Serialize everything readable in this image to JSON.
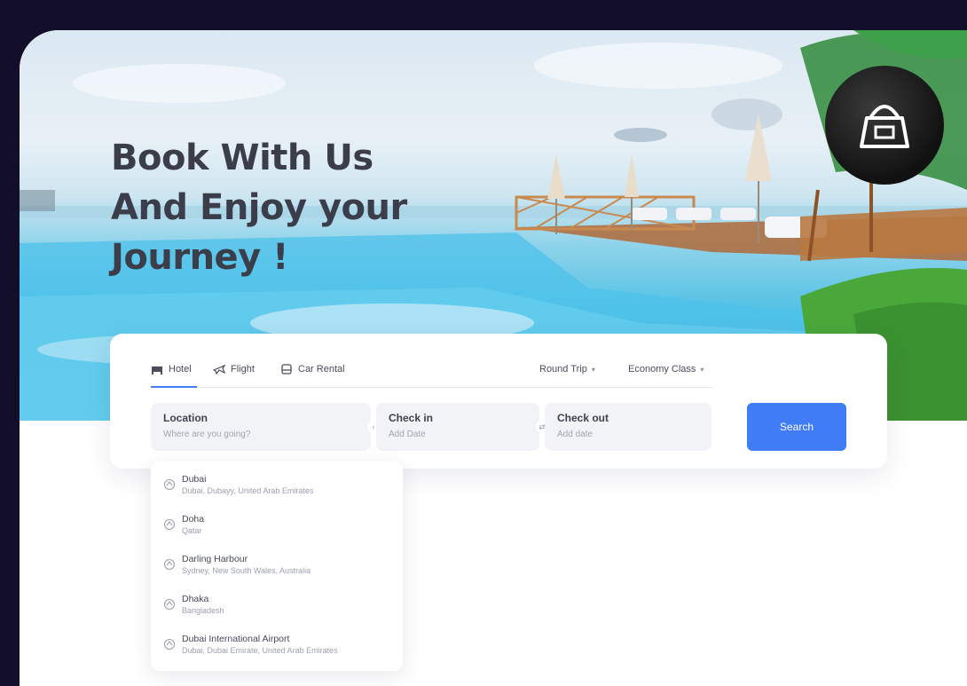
{
  "hero": {
    "headline": [
      "Book With Us",
      "And Enjoy your",
      "Journey !"
    ]
  },
  "badge": {
    "icon": "shopping-bag-icon"
  },
  "search": {
    "tabs": [
      {
        "label": "Hotel",
        "icon": "hotel-bed-icon",
        "active": true
      },
      {
        "label": "Flight",
        "icon": "plane-icon",
        "active": false
      },
      {
        "label": "Car Rental",
        "icon": "car-icon",
        "active": false
      }
    ],
    "selects": [
      {
        "label": "Round Trip"
      },
      {
        "label": "Economy Class"
      }
    ],
    "fields": {
      "location": {
        "label": "Location",
        "placeholder": "Where are you going?"
      },
      "checkin": {
        "label": "Check in",
        "placeholder": "Add Date"
      },
      "checkout": {
        "label": "Check out",
        "placeholder": "Add date"
      }
    },
    "button_label": "Search"
  },
  "suggestions": [
    {
      "name": "Dubai",
      "detail": "Dubai, Dubayy, United Arab Emirates"
    },
    {
      "name": "Doha",
      "detail": "Qatar"
    },
    {
      "name": "Darling Harbour",
      "detail": "Sydney, New South Wales, Australia"
    },
    {
      "name": "Dhaka",
      "detail": "Bangladesh"
    },
    {
      "name": "Dubai International Airport",
      "detail": "Dubai, Dubai Emirate, United Arab Emirates"
    }
  ],
  "colors": {
    "page_bg": "#130f2a",
    "accent": "#3f7cf6",
    "headline": "#3b3e4a"
  }
}
